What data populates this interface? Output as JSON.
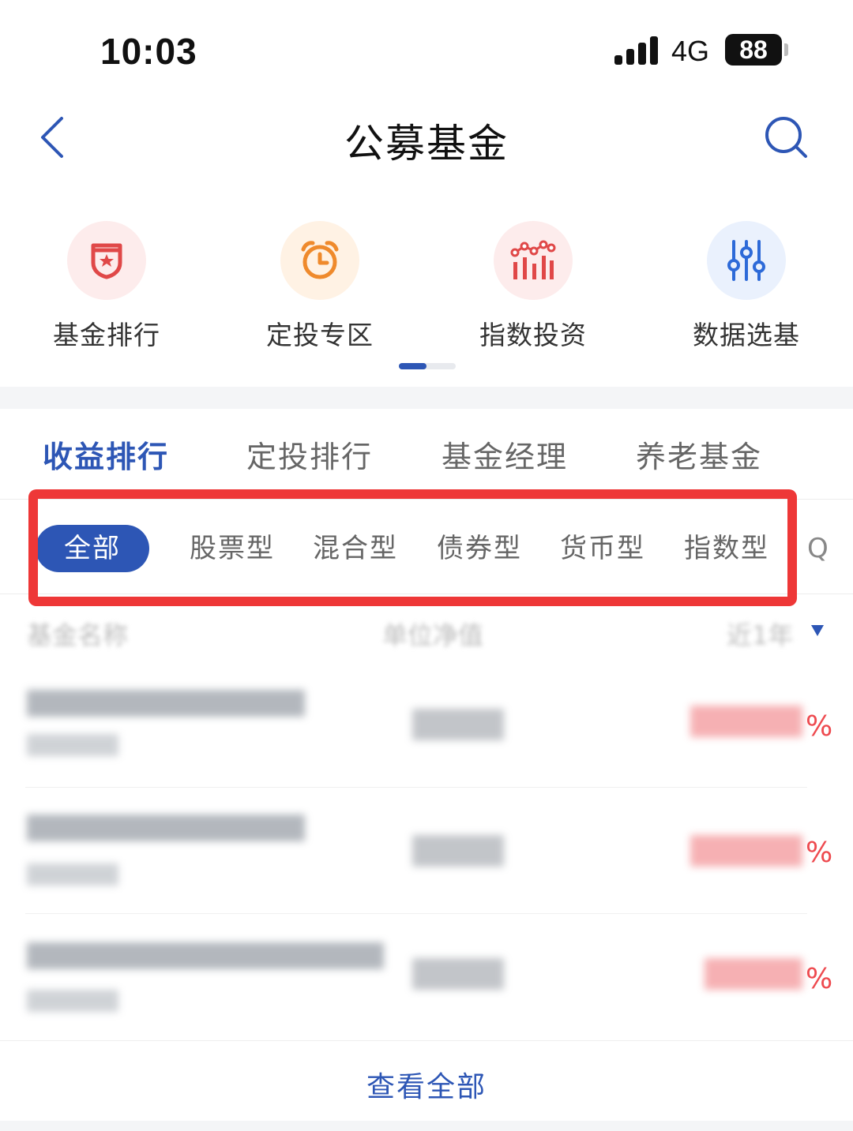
{
  "status_bar": {
    "time": "10:03",
    "network": "4G",
    "battery": "88"
  },
  "nav": {
    "title": "公募基金",
    "back_icon": "chevron-left-icon",
    "search_icon": "search-icon"
  },
  "quick_entries": [
    {
      "label": "基金排行",
      "icon": "badge-star-icon",
      "color": "#e04848",
      "bg": "#fdecec"
    },
    {
      "label": "定投专区",
      "icon": "alarm-clock-icon",
      "color": "#ef8a2c",
      "bg": "#fff2e4"
    },
    {
      "label": "指数投资",
      "icon": "bar-trend-icon",
      "color": "#e04848",
      "bg": "#fdecec"
    },
    {
      "label": "数据选基",
      "icon": "sliders-icon",
      "color": "#2d6ad8",
      "bg": "#eaf1fd"
    }
  ],
  "tabs": [
    {
      "label": "收益排行",
      "active": true
    },
    {
      "label": "定投排行",
      "active": false
    },
    {
      "label": "基金经理",
      "active": false
    },
    {
      "label": "养老基金",
      "active": false
    }
  ],
  "filters": [
    {
      "label": "全部",
      "active": true
    },
    {
      "label": "股票型",
      "active": false
    },
    {
      "label": "混合型",
      "active": false
    },
    {
      "label": "债券型",
      "active": false
    },
    {
      "label": "货币型",
      "active": false
    },
    {
      "label": "指数型",
      "active": false
    },
    {
      "label": "Q",
      "active": false
    }
  ],
  "table": {
    "headers": [
      "基金名称",
      "单位净值",
      "近1年"
    ],
    "rows": [
      {
        "pct": "%"
      },
      {
        "pct": "%"
      },
      {
        "pct": "%"
      }
    ]
  },
  "view_all": "查看全部",
  "colors": {
    "accent": "#2d56b5",
    "highlight": "#ee3737",
    "rise": "#ee4a4f"
  }
}
